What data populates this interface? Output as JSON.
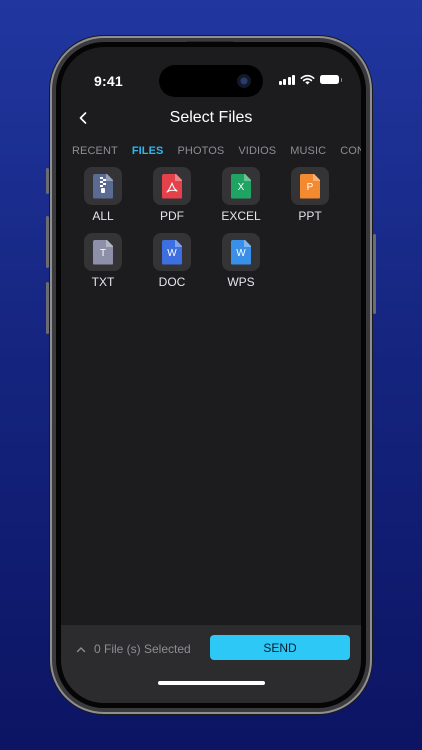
{
  "status_bar": {
    "time": "9:41",
    "icons": [
      "signal-icon",
      "wifi-icon",
      "battery-icon"
    ]
  },
  "header": {
    "title": "Select Files",
    "back_icon": "chevron-left-icon"
  },
  "tabs": [
    {
      "label": "RECENT",
      "active": false
    },
    {
      "label": "FILES",
      "active": true
    },
    {
      "label": "PHOTOS",
      "active": false
    },
    {
      "label": "VIDIOS",
      "active": false
    },
    {
      "label": "MUSIC",
      "active": false
    },
    {
      "label": "CONTACTS",
      "active": false
    }
  ],
  "file_types": [
    {
      "label": "ALL",
      "icon": "archive-file-icon",
      "glyph": "",
      "color": "#5b6a93"
    },
    {
      "label": "PDF",
      "icon": "pdf-file-icon",
      "glyph": "",
      "color": "#e5414b"
    },
    {
      "label": "EXCEL",
      "icon": "excel-file-icon",
      "glyph": "X",
      "color": "#1fa463"
    },
    {
      "label": "PPT",
      "icon": "ppt-file-icon",
      "glyph": "P",
      "color": "#f38a2f"
    },
    {
      "label": "TXT",
      "icon": "txt-file-icon",
      "glyph": "T",
      "color": "#8d90a8"
    },
    {
      "label": "DOC",
      "icon": "doc-file-icon",
      "glyph": "W",
      "color": "#3d6fe0"
    },
    {
      "label": "WPS",
      "icon": "wps-file-icon",
      "glyph": "W",
      "color": "#3a8fe8"
    }
  ],
  "bottom_bar": {
    "selected_text": "0 File (s) Selected",
    "send_label": "SEND",
    "expand_icon": "chevron-up-icon"
  },
  "colors": {
    "accent": "#2db8ee",
    "send_button": "#2ec8f7",
    "screen_bg": "#1c1c1e",
    "bottom_bar_bg": "#2c2c2e"
  }
}
